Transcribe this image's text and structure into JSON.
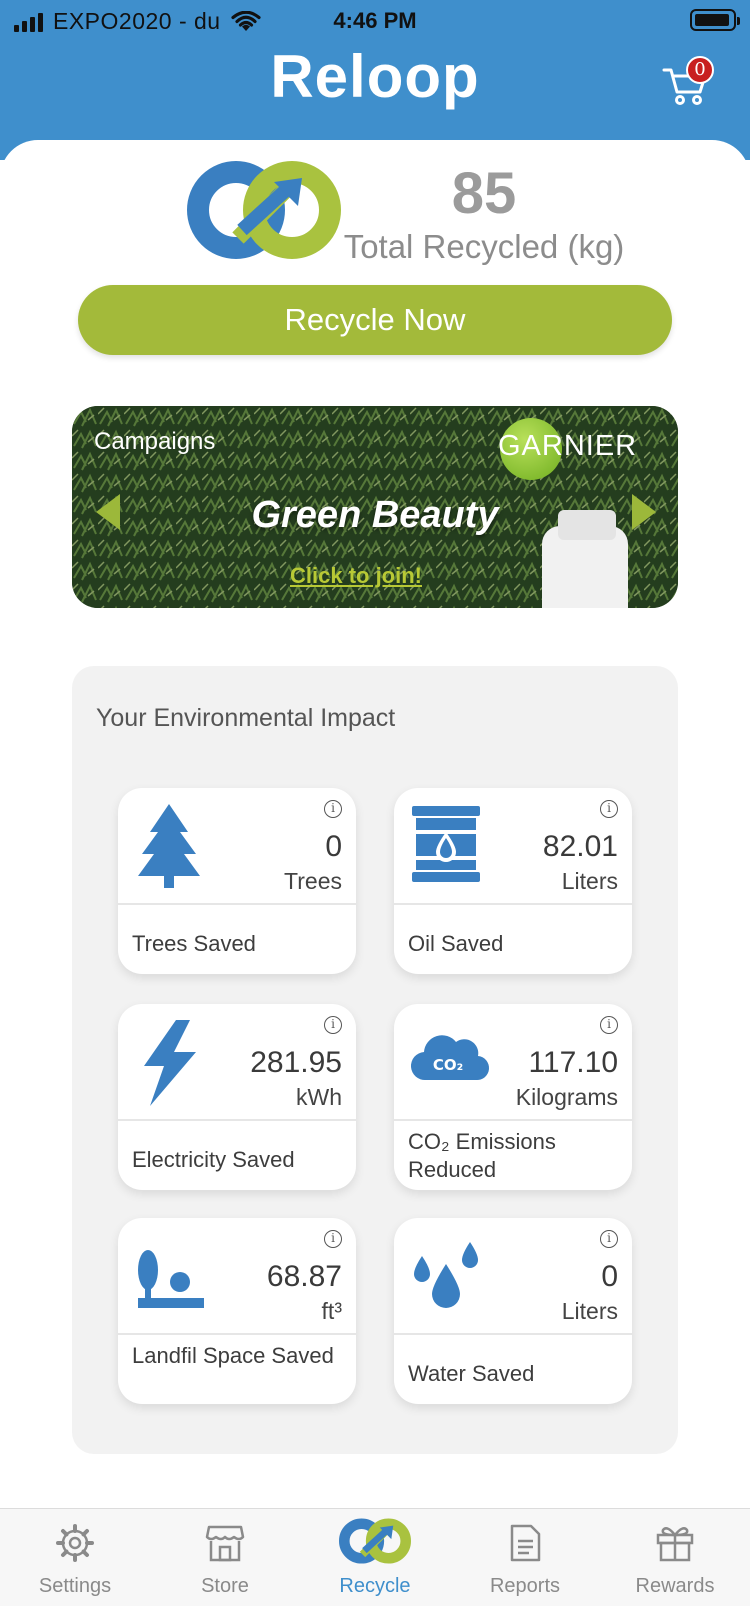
{
  "status_bar": {
    "carrier": "EXPO2020 - du",
    "time": "4:46 PM"
  },
  "header": {
    "brand": "Reloop",
    "cart_count": "0",
    "cart_icon": "cart-icon"
  },
  "summary": {
    "total_value": "85",
    "total_label": "Total Recycled (kg)",
    "recycle_button": "Recycle Now"
  },
  "campaign": {
    "section_label": "Campaigns",
    "brand": "GARNIER",
    "name": "Green Beauty",
    "cta": "Click to join!"
  },
  "impact": {
    "title": "Your Environmental Impact",
    "cards": [
      {
        "icon": "tree-icon",
        "value": "0",
        "unit": "Trees",
        "label": "Trees Saved"
      },
      {
        "icon": "oil-barrel-icon",
        "value": "82.01",
        "unit": "Liters",
        "label": "Oil Saved"
      },
      {
        "icon": "lightning-icon",
        "value": "281.95",
        "unit": "kWh",
        "label": "Electricity Saved"
      },
      {
        "icon": "co2-cloud-icon",
        "value": "117.10",
        "unit": "Kilograms",
        "label": "CO₂ Emissions Reduced"
      },
      {
        "icon": "landfill-icon",
        "value": "68.87",
        "unit": "ft³",
        "label": "Landfil Space Saved"
      },
      {
        "icon": "water-drops-icon",
        "value": "0",
        "unit": "Liters",
        "label": "Water Saved"
      }
    ],
    "info_glyph": "i"
  },
  "tabs": [
    {
      "label": "Settings",
      "icon": "gear-icon"
    },
    {
      "label": "Store",
      "icon": "store-icon"
    },
    {
      "label": "Recycle",
      "icon": "recycle-icon",
      "active": true
    },
    {
      "label": "Reports",
      "icon": "document-icon"
    },
    {
      "label": "Rewards",
      "icon": "gift-icon"
    }
  ],
  "colors": {
    "header_blue": "#3f8fcc",
    "accent_green": "#a3ba3a",
    "badge_red": "#c81f1f",
    "icon_blue": "#3a7fc1"
  }
}
